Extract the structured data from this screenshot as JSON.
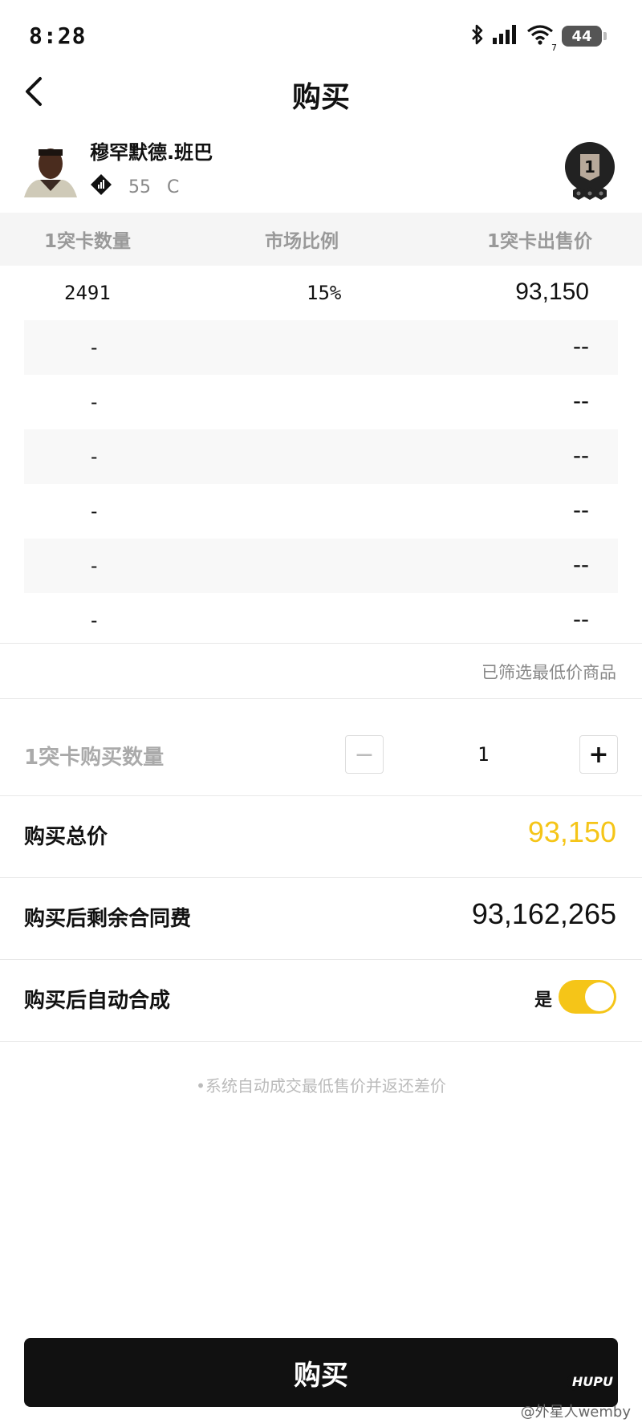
{
  "status_bar": {
    "time": "8:28",
    "battery": "44",
    "wifi_sub": "7"
  },
  "nav": {
    "title": "购买"
  },
  "player": {
    "name": "穆罕默德.班巴",
    "rating": "55",
    "position": "C",
    "rank": "1"
  },
  "table": {
    "headers": {
      "qty": "1突卡数量",
      "ratio": "市场比例",
      "price": "1突卡出售价"
    },
    "rows": [
      {
        "qty": "2491",
        "ratio": "15%",
        "price": "93,150"
      },
      {
        "qty": "-",
        "ratio": "",
        "price": "--"
      },
      {
        "qty": "-",
        "ratio": "",
        "price": "--"
      },
      {
        "qty": "-",
        "ratio": "",
        "price": "--"
      },
      {
        "qty": "-",
        "ratio": "",
        "price": "--"
      },
      {
        "qty": "-",
        "ratio": "",
        "price": "--"
      },
      {
        "qty": "-",
        "ratio": "",
        "price": "--"
      }
    ]
  },
  "filter_note": "已筛选最低价商品",
  "purchase": {
    "qty_label": "1突卡购买数量",
    "qty_value": "1",
    "minus": "−",
    "plus": "+",
    "total_label": "购买总价",
    "total_value": "93,150",
    "remaining_label": "购买后剩余合同费",
    "remaining_value": "93,162,265",
    "auto_label": "购买后自动合成",
    "auto_toggle_label": "是",
    "auto_enabled": true
  },
  "disclaimer": "•系统自动成交最低售价并返还差价",
  "buy_button": "购买",
  "watermark": {
    "logo": "HUPU",
    "text": "@外星人wemby"
  },
  "colors": {
    "accent": "#f5c518",
    "button": "#111111"
  }
}
